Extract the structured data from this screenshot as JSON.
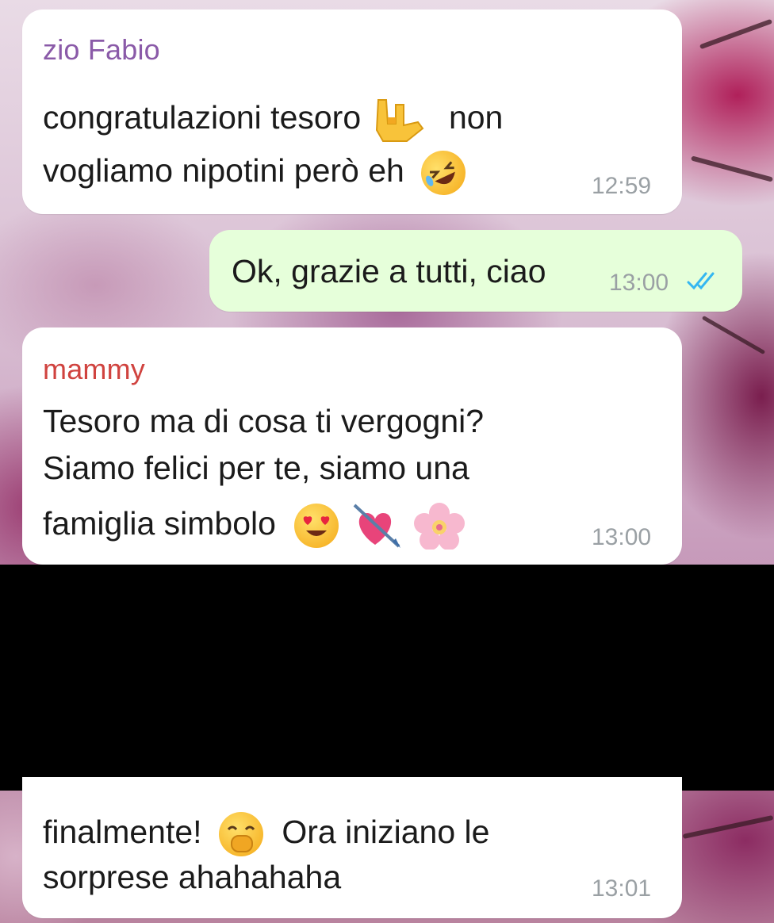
{
  "messages": [
    {
      "direction": "incoming",
      "sender": "zio Fabio",
      "sender_color": "#8a5aa8",
      "lines": [
        "congratulazioni tesoro",
        "non",
        "vogliamo nipotini però eh"
      ],
      "emojis": [
        "sign-of-the-horns-emoji",
        "rolling-on-floor-laughing-emoji"
      ],
      "time": "12:59"
    },
    {
      "direction": "outgoing",
      "lines": [
        "Ok, grazie a tutti, ciao"
      ],
      "time": "13:00",
      "status": "read",
      "status_icon": "double-check-icon",
      "status_color": "#34b7f1"
    },
    {
      "direction": "incoming",
      "sender": "mammy",
      "sender_color": "#d0433f",
      "lines": [
        "Tesoro ma di cosa ti vergogni?",
        "Siamo felici per te, siamo una",
        "famiglia simbolo"
      ],
      "emojis": [
        "smiling-face-with-heart-eyes-emoji",
        "heart-with-arrow-emoji",
        "cherry-blossom-emoji"
      ],
      "time": "13:00"
    },
    {
      "direction": "incoming",
      "lines": [
        "finalmente!",
        "Ora iniziano le",
        "sorprese ahahahaha"
      ],
      "emojis": [
        "face-with-hand-over-mouth-emoji"
      ],
      "time": "13:01"
    }
  ],
  "colors": {
    "incoming_bubble": "#ffffff",
    "outgoing_bubble": "#e6ffda",
    "timestamp": "#9aa0a4",
    "redaction": "#000000"
  }
}
